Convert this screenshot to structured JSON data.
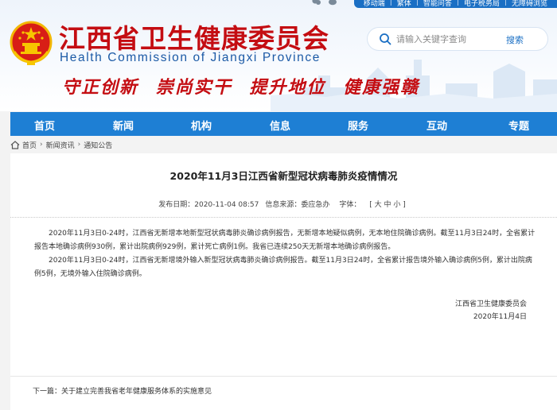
{
  "topbar": {
    "links": [
      "移动端",
      "繁体",
      "智能问答",
      "电子税务局",
      "无障碍浏览"
    ]
  },
  "header": {
    "title_cn": "江西省卫生健康委员会",
    "title_en": "Health Commission of Jiangxi Province",
    "slogan": [
      "守正创新",
      "崇尚实干",
      "提升地位",
      "健康强赣"
    ]
  },
  "search": {
    "placeholder": "请输入关键字查询",
    "button": "搜索"
  },
  "nav": {
    "items": [
      "首页",
      "新闻",
      "机构",
      "信息",
      "服务",
      "互动",
      "专题"
    ]
  },
  "breadcrumb": {
    "home": "首页",
    "items": [
      "新闻资讯",
      "通知公告"
    ]
  },
  "article": {
    "title": "2020年11月3日江西省新型冠状病毒肺炎疫情情况",
    "publish_time": "发布日期：2020-11-04 08:57",
    "source": "信息来源：委应急办",
    "font_label": "字体：",
    "font_sizes": "[ 大 中 小 ]",
    "paragraphs": [
      "2020年11月3日0-24时，江西省无新增本地新型冠状病毒肺炎确诊病例报告，无新增本地疑似病例，无本地住院确诊病例。截至11月3日24时，全省累计报告本地确诊病例930例，累计出院病例929例，累计死亡病例1例。我省已连续250天无新增本地确诊病例报告。",
      "2020年11月3日0-24时，江西省无新增境外输入新型冠状病毒肺炎确诊病例报告。截至11月3日24时，全省累计报告境外输入确诊病例5例，累计出院病例5例，无境外输入住院确诊病例。"
    ],
    "signature": "江西省卫生健康委员会",
    "date": "2020年11月4日"
  },
  "next": {
    "label": "下一篇：",
    "title": "关于建立完善我省老年健康服务体系的实施意见"
  },
  "colors": {
    "brand_red": "#c40d12",
    "nav_blue": "#1e7fd4",
    "english_blue": "#1c5aa6"
  }
}
